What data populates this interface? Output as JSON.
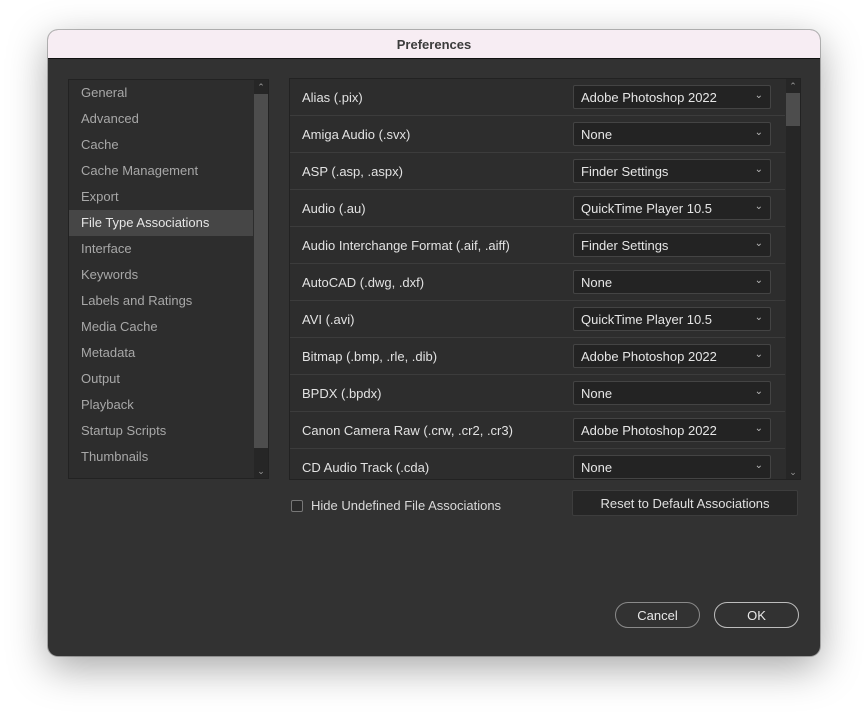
{
  "window": {
    "title": "Preferences"
  },
  "categories": [
    {
      "label": "General",
      "selected": false
    },
    {
      "label": "Advanced",
      "selected": false
    },
    {
      "label": "Cache",
      "selected": false
    },
    {
      "label": "Cache Management",
      "selected": false
    },
    {
      "label": "Export",
      "selected": false
    },
    {
      "label": "File Type Associations",
      "selected": true
    },
    {
      "label": "Interface",
      "selected": false
    },
    {
      "label": "Keywords",
      "selected": false
    },
    {
      "label": "Labels and Ratings",
      "selected": false
    },
    {
      "label": "Media Cache",
      "selected": false
    },
    {
      "label": "Metadata",
      "selected": false
    },
    {
      "label": "Output",
      "selected": false
    },
    {
      "label": "Playback",
      "selected": false
    },
    {
      "label": "Startup Scripts",
      "selected": false
    },
    {
      "label": "Thumbnails",
      "selected": false
    }
  ],
  "associations": [
    {
      "file_type": "Alias (.pix)",
      "app": "Adobe Photoshop 2022"
    },
    {
      "file_type": "Amiga Audio (.svx)",
      "app": "None"
    },
    {
      "file_type": "ASP (.asp, .aspx)",
      "app": "Finder Settings"
    },
    {
      "file_type": "Audio (.au)",
      "app": "QuickTime Player 10.5"
    },
    {
      "file_type": "Audio Interchange Format (.aif, .aiff)",
      "app": "Finder Settings"
    },
    {
      "file_type": "AutoCAD (.dwg, .dxf)",
      "app": "None"
    },
    {
      "file_type": "AVI (.avi)",
      "app": "QuickTime Player 10.5"
    },
    {
      "file_type": "Bitmap (.bmp, .rle, .dib)",
      "app": "Adobe Photoshop 2022"
    },
    {
      "file_type": "BPDX (.bpdx)",
      "app": "None"
    },
    {
      "file_type": "Canon Camera Raw (.crw, .cr2, .cr3)",
      "app": "Adobe Photoshop 2022"
    },
    {
      "file_type": "CD Audio Track (.cda)",
      "app": "None"
    }
  ],
  "controls": {
    "hide_undefined_label": "Hide Undefined File Associations",
    "hide_undefined_checked": false,
    "reset_label": "Reset to Default Associations",
    "cancel_label": "Cancel",
    "ok_label": "OK"
  },
  "icons": {
    "chevron_down": "⌄",
    "scroll_up": "⌃",
    "scroll_down": "⌄"
  }
}
